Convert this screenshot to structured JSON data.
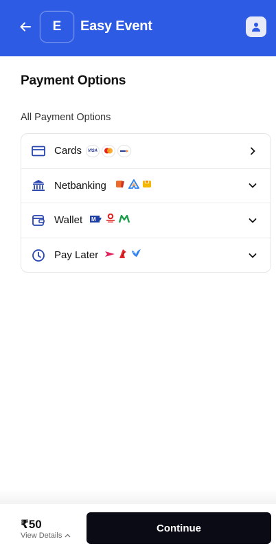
{
  "header": {
    "logo_letter": "E",
    "title": "Easy Event"
  },
  "page": {
    "title": "Payment Options",
    "section_label": "All Payment Options"
  },
  "payment_options": [
    {
      "label": "Cards",
      "icon": "credit-card-icon",
      "expand": "chevron-right"
    },
    {
      "label": "Netbanking",
      "icon": "bank-icon",
      "expand": "chevron-down"
    },
    {
      "label": "Wallet",
      "icon": "wallet-icon",
      "expand": "chevron-down"
    },
    {
      "label": "Pay Later",
      "icon": "clock-icon",
      "expand": "chevron-down"
    }
  ],
  "card_badges": [
    "VISA"
  ],
  "footer": {
    "amount": "₹50",
    "view_details": "View Details",
    "continue_label": "Continue"
  },
  "colors": {
    "header_bg": "#2d5be3",
    "icon_accent": "#2744b0",
    "button_bg": "#0a0b14"
  }
}
